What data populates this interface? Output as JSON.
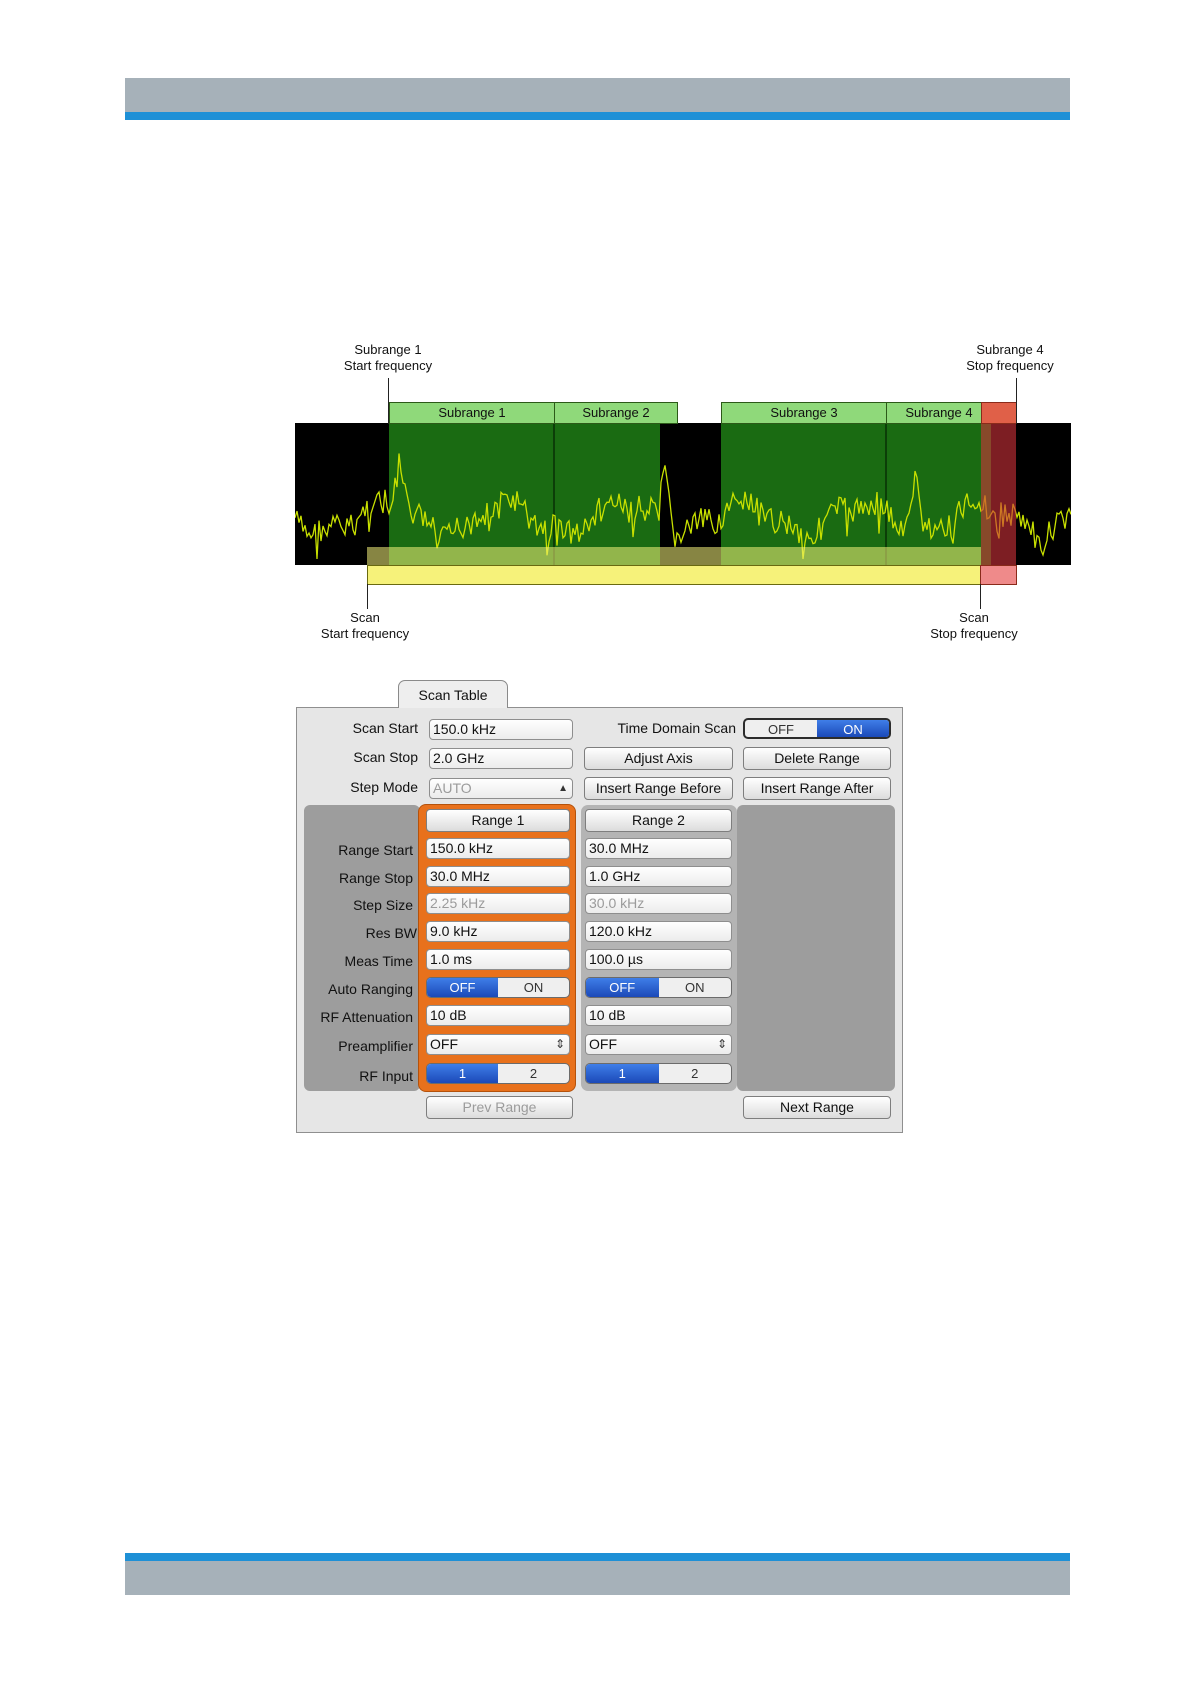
{
  "page": {
    "header_band_color": "#a6b1b9",
    "accent_line_color": "#1e90d6"
  },
  "figure": {
    "annotations": {
      "subrange1_start": "Subrange 1\nStart frequency",
      "subrange4_stop": "Subrange 4\nStop frequency",
      "scan_start": "Scan\nStart frequency",
      "scan_stop": "Scan\nStop frequency"
    },
    "subranges": [
      "Subrange 1",
      "Subrange 2",
      "Subrange 3",
      "Subrange 4"
    ],
    "colors": {
      "subrange_fill": "#8fd97a",
      "scan_band": "#f6f27a",
      "stop_band": "#d0323a",
      "trace": "#c8e000"
    }
  },
  "scan_table": {
    "tab_label": "Scan Table",
    "scan_start": {
      "label": "Scan Start",
      "value": "150.0 kHz"
    },
    "scan_stop": {
      "label": "Scan Stop",
      "value": "2.0 GHz"
    },
    "step_mode": {
      "label": "Step Mode",
      "value": "AUTO"
    },
    "time_domain_scan": {
      "label": "Time Domain Scan",
      "off": "OFF",
      "on": "ON",
      "selected": "ON"
    },
    "buttons": {
      "adjust_axis": "Adjust Axis",
      "delete_range": "Delete Range",
      "insert_before": "Insert Range Before",
      "insert_after": "Insert Range After",
      "prev_range": "Prev Range",
      "next_range": "Next Range"
    },
    "row_labels": [
      "Range Start",
      "Range Stop",
      "Step Size",
      "Res BW",
      "Meas Time",
      "Auto Ranging",
      "RF Attenuation",
      "Preamplifier",
      "RF Input"
    ],
    "ranges": [
      {
        "title": "Range 1",
        "range_start": "150.0 kHz",
        "range_stop": "30.0 MHz",
        "step_size": "2.25 kHz",
        "res_bw": "9.0 kHz",
        "meas_time": "1.0 ms",
        "auto_ranging": {
          "off": "OFF",
          "on": "ON",
          "selected": "OFF"
        },
        "rf_attenuation": "10 dB",
        "preamplifier": "OFF",
        "rf_input": {
          "a": "1",
          "b": "2",
          "selected": "1"
        },
        "highlighted": true
      },
      {
        "title": "Range 2",
        "range_start": "30.0 MHz",
        "range_stop": "1.0 GHz",
        "step_size": "30.0 kHz",
        "res_bw": "120.0 kHz",
        "meas_time": "100.0 µs",
        "auto_ranging": {
          "off": "OFF",
          "on": "ON",
          "selected": "OFF"
        },
        "rf_attenuation": "10 dB",
        "preamplifier": "OFF",
        "rf_input": {
          "a": "1",
          "b": "2",
          "selected": "1"
        },
        "highlighted": false
      }
    ]
  }
}
